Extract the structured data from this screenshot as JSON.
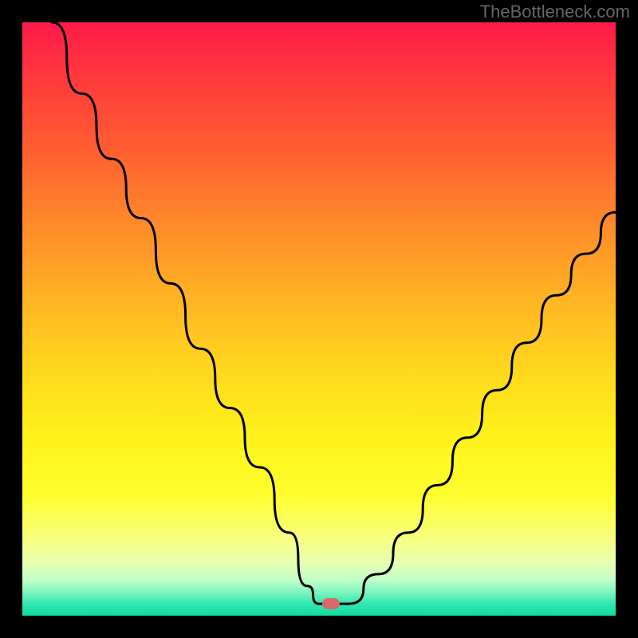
{
  "watermark": "TheBottleneck.com",
  "chart_data": {
    "type": "line",
    "title": "",
    "xlabel": "",
    "ylabel": "",
    "xlim": [
      0,
      100
    ],
    "ylim": [
      0,
      100
    ],
    "series": [
      {
        "name": "bottleneck-curve",
        "x": [
          5,
          10,
          15,
          20,
          25,
          30,
          35,
          40,
          45,
          48,
          50,
          52,
          55,
          60,
          65,
          70,
          75,
          80,
          85,
          90,
          95,
          100
        ],
        "y": [
          100,
          88,
          77,
          67,
          56,
          45,
          35,
          25,
          14,
          5,
          2,
          2,
          2,
          7,
          14,
          22,
          30,
          38,
          46,
          54,
          61,
          68
        ]
      }
    ],
    "marker": {
      "x": 52,
      "y": 2,
      "color": "#d96a6a"
    },
    "background_gradient": {
      "top_color": "#ff1a4a",
      "mid_color": "#ffff30",
      "bottom_color": "#10dca0"
    },
    "grid": false,
    "legend": false
  }
}
